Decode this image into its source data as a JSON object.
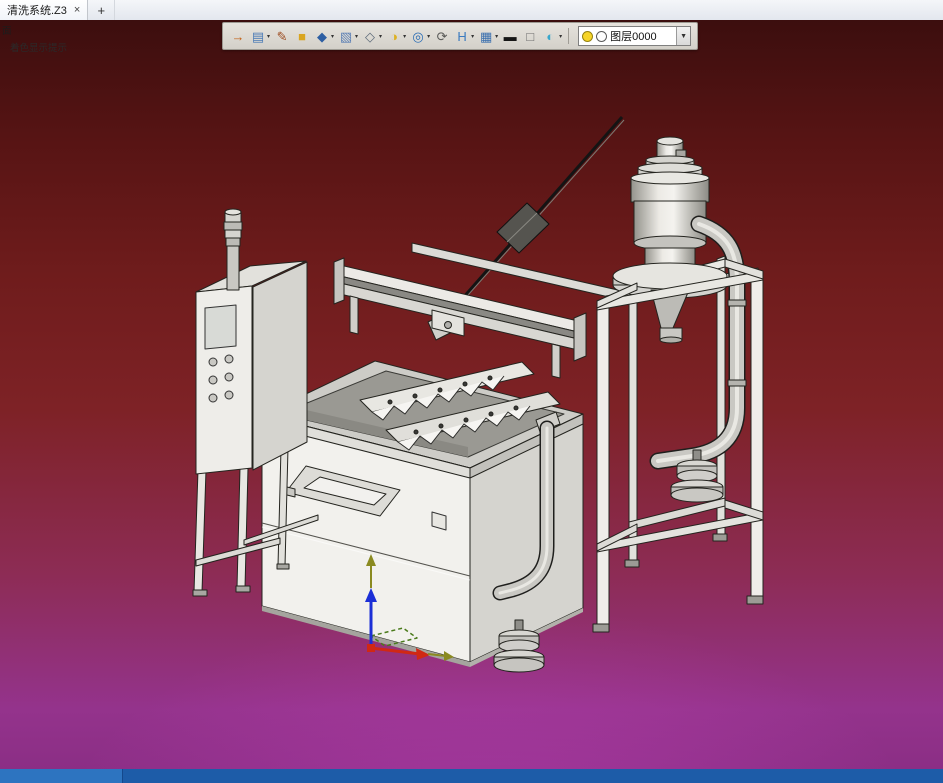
{
  "tabbar": {
    "active_tab": "清洗系统.Z3",
    "close_glyph": "×",
    "new_tab_glyph": "+"
  },
  "prompt": {
    "line1": "面",
    "line2": "着色显示提示"
  },
  "toolbar": {
    "caret_glyph": "▾",
    "icons": [
      {
        "name": "exit-environment-icon",
        "glyph": "→",
        "color": "#c35f12",
        "caret": false
      },
      {
        "name": "save-file-icon",
        "glyph": "▤",
        "color": "#4a7ab5",
        "caret": true
      },
      {
        "name": "edit-sketch-icon",
        "glyph": "✎",
        "color": "#9c4a1e",
        "caret": false
      },
      {
        "name": "extrude-box-icon",
        "glyph": "■",
        "color": "#d9a520",
        "caret": false
      },
      {
        "name": "solid-cube-icon",
        "glyph": "◆",
        "color": "#2e5fa3",
        "caret": true
      },
      {
        "name": "shaded-display-icon",
        "glyph": "▧",
        "color": "#5b7fb5",
        "caret": true
      },
      {
        "name": "wireframe-display-icon",
        "glyph": "◇",
        "color": "#5d6b7a",
        "caret": true
      },
      {
        "name": "color-style-icon",
        "glyph": "◑",
        "color": "#ddb123",
        "caret": true
      },
      {
        "name": "zoom-icon",
        "glyph": "◎",
        "color": "#2a6db5",
        "caret": true
      },
      {
        "name": "rotate-view-icon",
        "glyph": "⟳",
        "color": "#5a5a58",
        "caret": false
      },
      {
        "name": "align-plane-icon",
        "glyph": "H",
        "color": "#3a7abf",
        "caret": true
      },
      {
        "name": "render-mode-icon",
        "glyph": "▦",
        "color": "#3a6fae",
        "caret": true
      },
      {
        "name": "dark-material-icon",
        "glyph": "▬",
        "color": "#161616",
        "caret": false
      },
      {
        "name": "light-material-icon",
        "glyph": "□",
        "color": "#6e6e6e",
        "caret": false
      },
      {
        "name": "section-view-icon",
        "glyph": "◐",
        "color": "#38a7cc",
        "caret": true
      }
    ],
    "layer_combo": {
      "value": "图层0000",
      "caret": "▼"
    }
  },
  "viewport": {
    "background_top_color": "#3c0e0e",
    "background_bottom_color": "#94338c",
    "model_color": "#f0efec",
    "edge_color": "#222220"
  },
  "triad": {
    "x_axis_color": "#d02814",
    "z_axis_color": "#1c2fd6",
    "extension_color": "#8a8a20",
    "plane_color": "#4a7a1a"
  },
  "bottombar": {
    "main_color": "#1d5ca8",
    "left_segment_color": "#2d74c0"
  }
}
